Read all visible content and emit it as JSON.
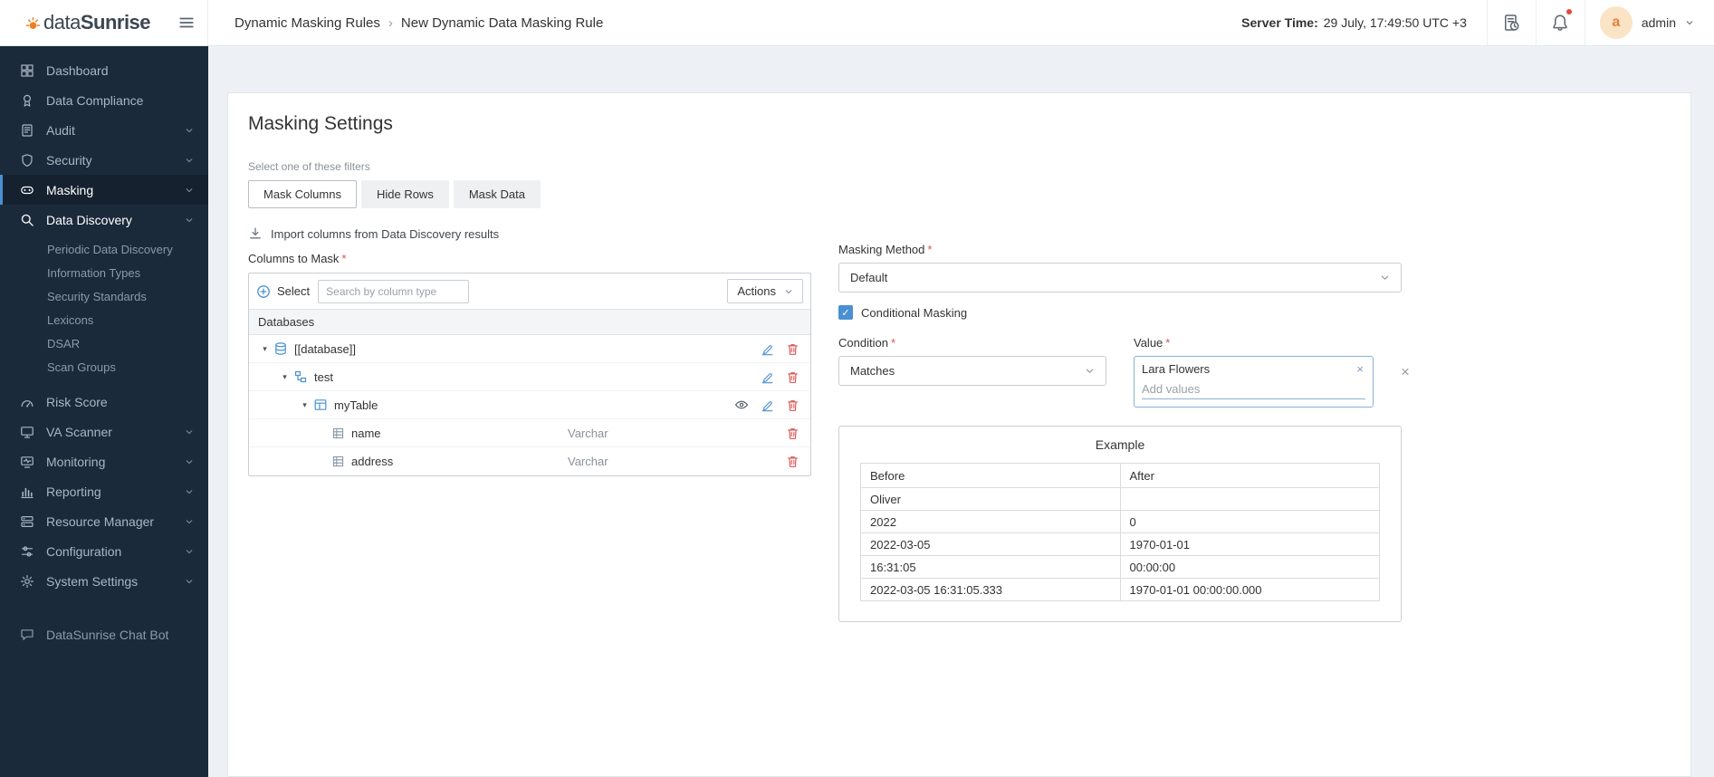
{
  "topbar": {
    "logo_part1": "data",
    "logo_part2": "Sunrise",
    "breadcrumb": {
      "parent": "Dynamic Masking Rules",
      "separator": "›",
      "current": "New Dynamic Data Masking Rule"
    },
    "server_time_label": "Server Time:",
    "server_time_value": "29 July, 17:49:50 UTC +3",
    "user": {
      "initial": "a",
      "name": "admin"
    }
  },
  "sidebar": {
    "items": [
      {
        "label": "Dashboard",
        "icon": "dashboard-icon",
        "expandable": false
      },
      {
        "label": "Data Compliance",
        "icon": "data-compliance-icon",
        "expandable": false
      },
      {
        "label": "Audit",
        "icon": "audit-icon",
        "expandable": true
      },
      {
        "label": "Security",
        "icon": "security-icon",
        "expandable": true
      },
      {
        "label": "Masking",
        "icon": "masking-icon",
        "expandable": true,
        "active": true
      },
      {
        "label": "Data Discovery",
        "icon": "data-discovery-icon",
        "expandable": true,
        "expanded": true
      },
      {
        "label": "Risk Score",
        "icon": "risk-score-icon",
        "expandable": false
      },
      {
        "label": "VA Scanner",
        "icon": "va-scanner-icon",
        "expandable": true
      },
      {
        "label": "Monitoring",
        "icon": "monitoring-icon",
        "expandable": true
      },
      {
        "label": "Reporting",
        "icon": "reporting-icon",
        "expandable": true
      },
      {
        "label": "Resource Manager",
        "icon": "resource-manager-icon",
        "expandable": true
      },
      {
        "label": "Configuration",
        "icon": "configuration-icon",
        "expandable": true
      },
      {
        "label": "System Settings",
        "icon": "system-settings-icon",
        "expandable": true
      }
    ],
    "discovery_subitems": [
      "Periodic Data Discovery",
      "Information Types",
      "Security Standards",
      "Lexicons",
      "DSAR",
      "Scan Groups"
    ],
    "chat_bot_label": "DataSunrise Chat Bot"
  },
  "main": {
    "title": "Masking Settings",
    "filters": {
      "label": "Select one of these filters",
      "buttons": [
        "Mask Columns",
        "Hide Rows",
        "Mask Data"
      ],
      "active_button": "Mask Columns"
    },
    "import_label": "Import columns from Data Discovery results",
    "columns_to_mask_label": "Columns to Mask",
    "tree": {
      "select_label": "Select",
      "search_placeholder": "Search by column type",
      "actions_label": "Actions",
      "group_header": "Databases",
      "rows": [
        {
          "label": "[[database]]",
          "depth": 0,
          "icon": "database-icon"
        },
        {
          "label": "test",
          "depth": 1,
          "icon": "schema-icon"
        },
        {
          "label": "myTable",
          "depth": 2,
          "icon": "table-icon"
        },
        {
          "label": "name",
          "depth": 3,
          "icon": "column-icon",
          "type": "Varchar"
        },
        {
          "label": "address",
          "depth": 3,
          "icon": "column-icon",
          "type": "Varchar"
        }
      ]
    },
    "masking_method": {
      "label": "Masking Method",
      "value": "Default"
    },
    "conditional_masking_label": "Conditional Masking",
    "conditional_masking_checked": true,
    "condition": {
      "label": "Condition",
      "value": "Matches"
    },
    "value": {
      "label": "Value",
      "tags": [
        "Lara Flowers"
      ],
      "add_placeholder": "Add values"
    },
    "example": {
      "title": "Example",
      "columns": [
        "Before",
        "After"
      ],
      "rows": [
        [
          "Oliver",
          ""
        ],
        [
          "2022",
          "0"
        ],
        [
          "2022-03-05",
          "1970-01-01"
        ],
        [
          "16:31:05",
          "00:00:00"
        ],
        [
          "2022-03-05 16:31:05.333",
          "1970-01-01 00:00:00.000"
        ]
      ]
    }
  },
  "icons": {
    "caret_expanded": "▾",
    "close": "×",
    "check": "✓"
  },
  "misc": {
    "required_mark": "*"
  },
  "colors": {
    "accent": "#4a90d2",
    "danger": "#d9534f",
    "sidebar_bg": "#1b2a3a",
    "brand_orange": "#f07d23",
    "notification_red": "#e6493b",
    "content_bg": "#edf0f4"
  }
}
